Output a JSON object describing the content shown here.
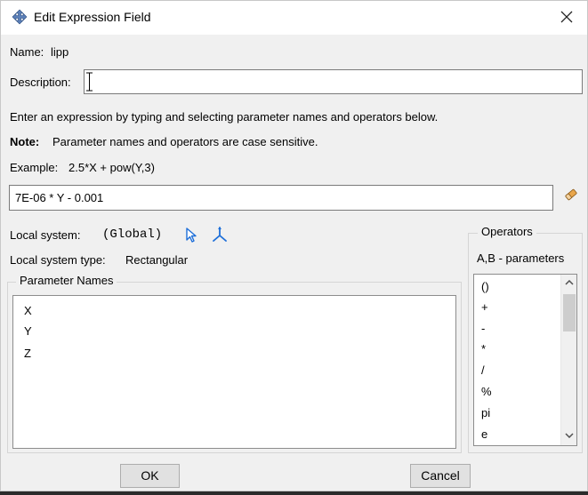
{
  "window": {
    "title": "Edit Expression Field",
    "close_symbol": "✕"
  },
  "name_row": {
    "label": "Name:",
    "value": "lipp"
  },
  "description": {
    "label": "Description:",
    "value": ""
  },
  "instructions": {
    "line1": "Enter an expression by typing and selecting parameter names and operators below.",
    "note_label": "Note:",
    "note_text": "Parameter names and operators are case sensitive.",
    "example_label": "Example:",
    "example_text": "2.5*X + pow(Y,3)"
  },
  "expression": {
    "value": "7E-06 *  Y - 0.001"
  },
  "local_system": {
    "label": "Local system:",
    "value": "(Global)"
  },
  "local_system_type": {
    "label": "Local system type:",
    "value": "Rectangular"
  },
  "parameter_names": {
    "title": "Parameter Names",
    "items": [
      "X",
      "Y",
      "Z"
    ]
  },
  "operators": {
    "title": "Operators",
    "subtitle": "A,B - parameters",
    "items": [
      "()",
      "+",
      "-",
      "*",
      "/",
      "%",
      "pi",
      "e"
    ]
  },
  "buttons": {
    "ok": "OK",
    "cancel": "Cancel"
  },
  "icons": {
    "title": "dialog-app-icon",
    "eraser": "eraser-icon",
    "pointer": "select-pointer-icon",
    "axes": "coordinate-axes-icon"
  },
  "colors": {
    "accent": "#0078d7",
    "icon_blue": "#1e6fd9"
  }
}
